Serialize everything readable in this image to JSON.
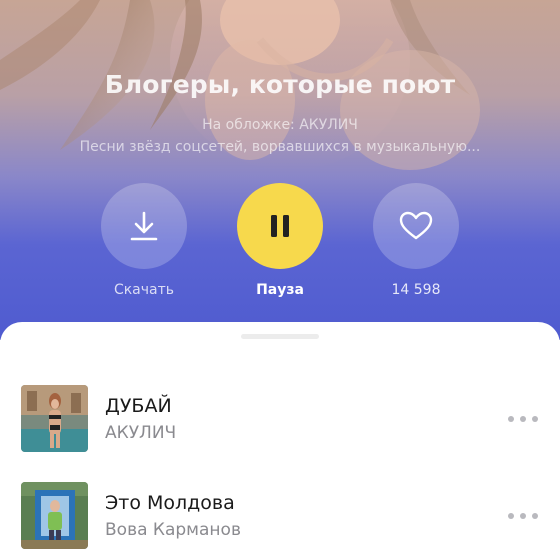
{
  "playlist": {
    "title": "Блогеры, которые поют",
    "cover_line": "На обложке: АКУЛИЧ",
    "description": "Песни звёзд соцсетей, ворвавшихся в музыкальную..."
  },
  "actions": {
    "download_label": "Скачать",
    "pause_label": "Пауза",
    "likes_count": "14 598"
  },
  "colors": {
    "accent_yellow": "#f7d94c",
    "hero_blue": "#4f5bd0",
    "artist_gray": "#8a8a8f"
  },
  "tracks": [
    {
      "title": "ДУБАЙ",
      "artist": "АКУЛИЧ"
    },
    {
      "title": "Это Молдова",
      "artist": "Вова Карманов"
    }
  ]
}
